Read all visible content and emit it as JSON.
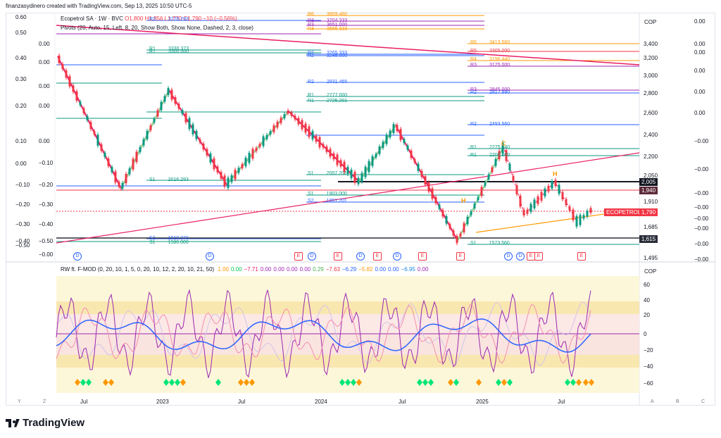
{
  "header": {
    "caption": "finanzasydinero created with TradingView.com, Sep 13, 2025 10:50 UTC-5"
  },
  "symbol": {
    "name": "Ecopetrol SA · 1W · BVC",
    "ohlc": "O1,800 H1,856 L1,770 C1,790 −10 (−0.56%)",
    "pivots": "Pivots (20, Auto, 15, Left, 8, 20, Show Both, Show None, Dashed, 2, 3, close)"
  },
  "oscillator": {
    "name": "RW ft. F-MOD (0, 20, 10, 1, 5, 0, 20, 10, 12, 2, 20, 10, 21, 50)",
    "values": [
      {
        "v": "1.00",
        "c": "#ff9800"
      },
      {
        "v": "0.00",
        "c": "#00c853"
      },
      {
        "v": "−7.71",
        "c": "#e91e63"
      },
      {
        "v": "0.00",
        "c": "#9c27b0"
      },
      {
        "v": "0.00",
        "c": "#9c27b0"
      },
      {
        "v": "0.00",
        "c": "#9c27b0"
      },
      {
        "v": "0.00",
        "c": "#9c27b0"
      },
      {
        "v": "0.29",
        "c": "#4caf50"
      },
      {
        "v": "−7.63",
        "c": "#f23645"
      },
      {
        "v": "−6.29",
        "c": "#2962ff"
      },
      {
        "v": "−5.82",
        "c": "#ff9800"
      },
      {
        "v": "0.00",
        "c": "#2962ff"
      },
      {
        "v": "0.00",
        "c": "#2962ff"
      },
      {
        "v": "−6.95",
        "c": "#1e88e5"
      },
      {
        "v": "0.00",
        "c": "#9c27b0"
      }
    ]
  },
  "price_axis": {
    "currency": "COP",
    "ticks": [
      "3,400",
      "3,200",
      "3,000",
      "2,800",
      "2,600",
      "2,400",
      "2,200",
      "2,050",
      "1,910",
      "1,685",
      "1,495"
    ],
    "labels": [
      {
        "text": "2,005",
        "bg": "#131722"
      },
      {
        "text": "1,940",
        "bg": "#5d2a3a"
      },
      {
        "text": "1,790",
        "bg": "#f23645"
      },
      {
        "text": "1,615",
        "bg": "#2a2e39"
      }
    ],
    "symbol_tag": "ECOPETROL"
  },
  "left_axis": {
    "ticks": [
      "0.60",
      "0.50",
      "0.40",
      "0.30",
      "0.20",
      "0.10",
      "0.00",
      "−0.10",
      "−0.20",
      "−0.30",
      "−0.40",
      "−0.50"
    ]
  },
  "left_axis2": {
    "ticks": [
      "0.00",
      "0.00",
      "0.00",
      "0.00",
      "0.00",
      "−0.10",
      "−0.20",
      "−0.30",
      "−0.40",
      "−0.50",
      "−0.00"
    ]
  },
  "right_axis2": {
    "ticks": [
      "0.00",
      "0.00",
      "0.00",
      "0.00",
      "0.00",
      "0.00",
      "−0.00",
      "−0.00",
      "−0.00",
      "−0.00",
      "−0.00",
      "−0.00",
      "−0.00",
      "−0.00",
      "−0.00"
    ]
  },
  "osc_axis": {
    "currency": "COP",
    "ticks": [
      "60",
      "40",
      "20",
      "0",
      "−20",
      "−40",
      "−60"
    ]
  },
  "time_axis": {
    "ticks": [
      "Jul",
      "2023",
      "Jul",
      "2024",
      "Jul",
      "2025",
      "Jul"
    ]
  },
  "bottom_buttons": {
    "left": [
      "Y",
      "Z"
    ],
    "right": [
      "A",
      "B",
      "C"
    ]
  },
  "pivot_labels": [
    {
      "t": "R2",
      "v": "3776.293",
      "c": "#2962ff"
    },
    {
      "t": "R1",
      "v": "3330.373",
      "c": "#089981"
    },
    {
      "t": "R1",
      "v": "3300.000",
      "c": "#089981"
    },
    {
      "t": "R2",
      "v": "2931.465",
      "c": "#2962ff"
    },
    {
      "t": "S1",
      "v": "2016.293",
      "c": "#089981"
    },
    {
      "t": "S2",
      "v": "1610.373",
      "c": "#2962ff"
    },
    {
      "t": "S1",
      "v": "1580.000",
      "c": "#089981"
    },
    {
      "t": "R6",
      "v": "3809.460",
      "c": "#ff9800"
    },
    {
      "t": "R3",
      "v": "3704.333",
      "c": "#9c27b0"
    },
    {
      "t": "R3",
      "v": "3651.000",
      "c": "#9c27b0"
    },
    {
      "t": "R4",
      "v": "3555.333",
      "c": "#ff9800"
    },
    {
      "t": "R2",
      "v": "3265.333",
      "c": "#2962ff"
    },
    {
      "t": "R2",
      "v": "3245.000",
      "c": "#2962ff"
    },
    {
      "t": "R1",
      "v": "2777.000",
      "c": "#089981"
    },
    {
      "t": "R1",
      "v": "2725.201",
      "c": "#089981"
    },
    {
      "t": "S1",
      "v": "2057.201",
      "c": "#089981"
    },
    {
      "t": "S1",
      "v": "1903.000",
      "c": "#089981"
    },
    {
      "t": "S2",
      "v": "1851.201",
      "c": "#2962ff"
    },
    {
      "t": "R6",
      "v": "3413.560",
      "c": "#ff9800"
    },
    {
      "t": "R5",
      "v": "3305.000",
      "c": "#f23645"
    },
    {
      "t": "R4",
      "v": "3196.440",
      "c": "#ff9800"
    },
    {
      "t": "R3",
      "v": "3125.000",
      "c": "#9c27b0"
    },
    {
      "t": "R3",
      "v": "2845.000",
      "c": "#9c27b0"
    },
    {
      "t": "R2",
      "v": "2817.880",
      "c": "#2962ff"
    },
    {
      "t": "R2",
      "v": "2493.560",
      "c": "#2962ff"
    },
    {
      "t": "R1",
      "v": "2275.440",
      "c": "#089981"
    },
    {
      "t": "R1",
      "v": "2200.000",
      "c": "#089981"
    },
    {
      "t": "S1",
      "v": "1573.560",
      "c": "#089981"
    }
  ],
  "wave_labels": [
    "C",
    "H",
    "H"
  ],
  "events": [
    "D",
    "D",
    "E",
    "D",
    "E",
    "D",
    "E",
    "D",
    "E",
    "E",
    "D",
    "D",
    "E",
    "E",
    "E"
  ],
  "brand": "TradingView"
}
